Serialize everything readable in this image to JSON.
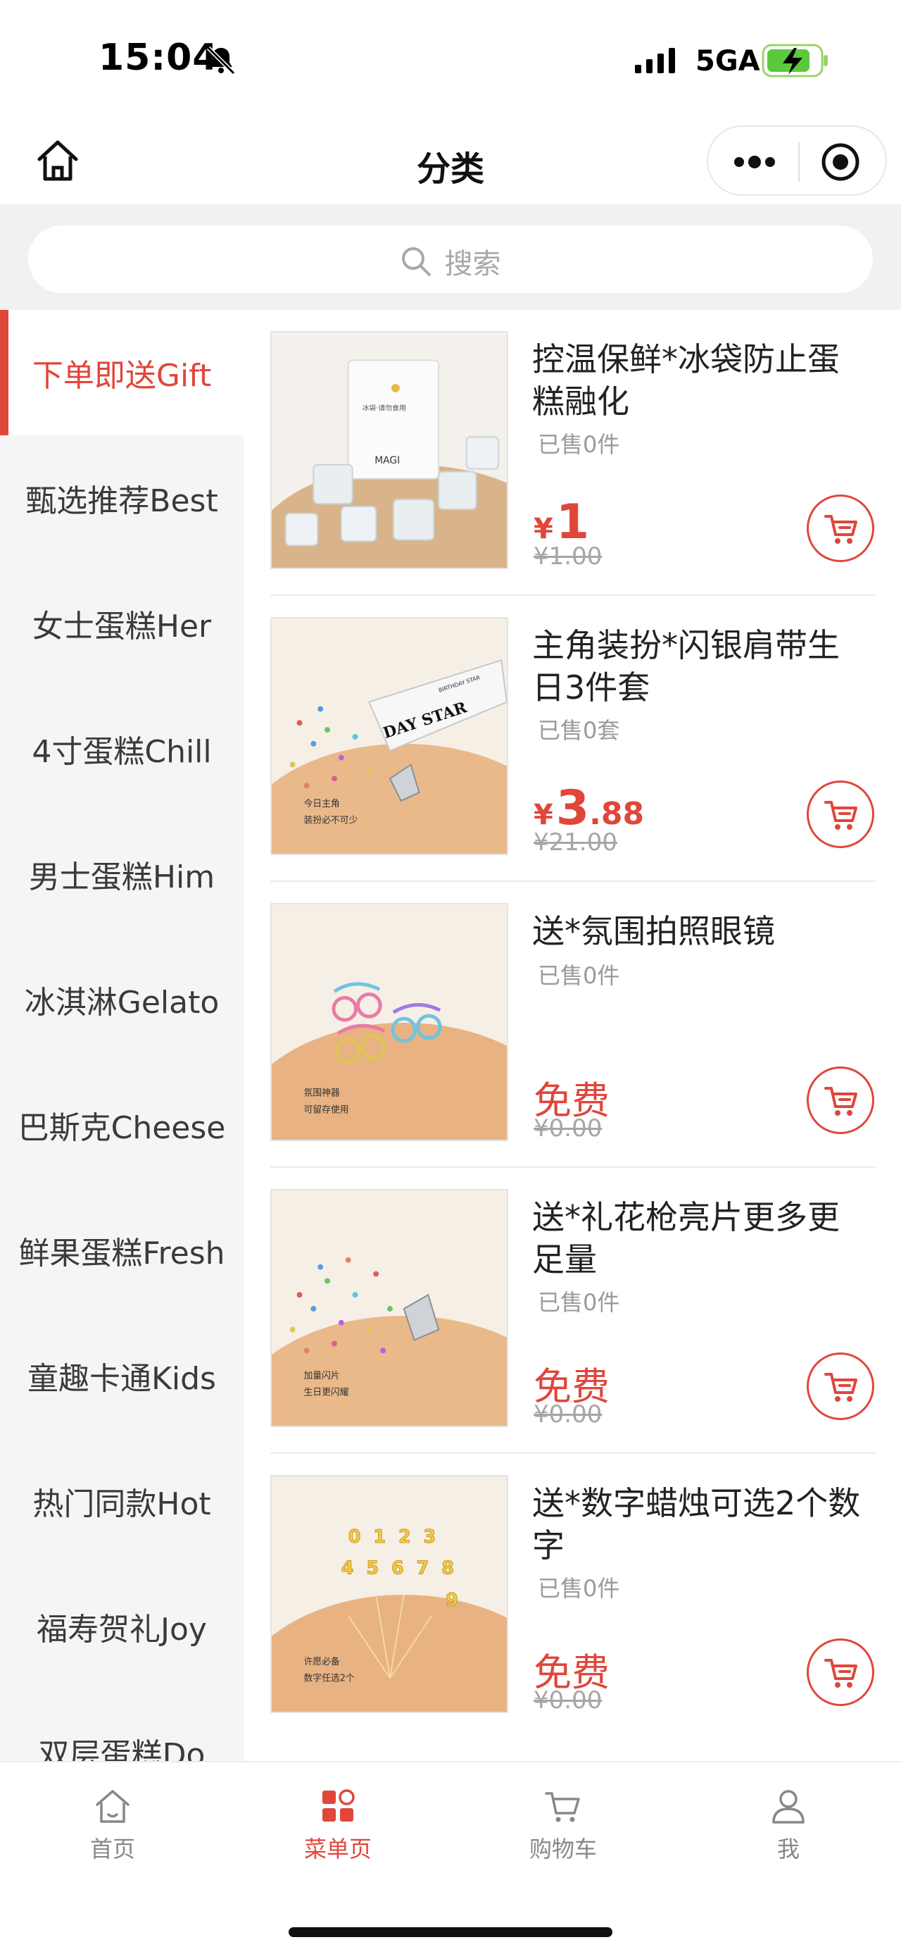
{
  "status_bar": {
    "time": "15:04",
    "network": "5GA"
  },
  "nav": {
    "title": "分类"
  },
  "search": {
    "placeholder": "搜索"
  },
  "categories": [
    {
      "label": "下单即送Gift",
      "active": true
    },
    {
      "label": "甄选推荐Best"
    },
    {
      "label": "女士蛋糕Her"
    },
    {
      "label": "4寸蛋糕Chill"
    },
    {
      "label": "男士蛋糕Him"
    },
    {
      "label": "冰淇淋Gelato"
    },
    {
      "label": "巴斯克Cheese"
    },
    {
      "label": "鲜果蛋糕Fresh"
    },
    {
      "label": "童趣卡通Kids"
    },
    {
      "label": "热门同款Hot"
    },
    {
      "label": "福寿贺礼Joy"
    },
    {
      "label": "双层蛋糕Do"
    }
  ],
  "products": [
    {
      "name": "控温保鲜*冰袋防止蛋糕融化",
      "sold": "已售0件",
      "price_symbol": "¥",
      "price_int": "1",
      "price_dec": "",
      "original_price": "¥1.00",
      "image_texts": [
        "MAGI",
        "冰袋·请勿食用"
      ]
    },
    {
      "name": "主角装扮*闪银肩带生日3件套",
      "sold": "已售0套",
      "price_symbol": "¥",
      "price_int": "3",
      "price_dec": ".88",
      "original_price": "¥21.00",
      "image_texts": [
        "DAY STAR",
        "BIRTHDAY STAR",
        "今日主角",
        "装扮必不可少"
      ]
    },
    {
      "name": "送*氛围拍照眼镜",
      "sold": "已售0件",
      "price_free": "免费",
      "original_price": "¥0.00",
      "image_texts": [
        "氛围神器",
        "可留存使用"
      ]
    },
    {
      "name": "送*礼花枪亮片更多更足量",
      "sold": "已售0件",
      "price_free": "免费",
      "original_price": "¥0.00",
      "image_texts": [
        "加量闪片",
        "生日更闪耀"
      ]
    },
    {
      "name": "送*数字蜡烛可选2个数字",
      "sold": "已售0件",
      "price_free": "免费",
      "original_price": "¥0.00",
      "image_texts": [
        "许愿必备",
        "数字任选2个",
        "0",
        "1",
        "2",
        "3",
        "4",
        "5",
        "6",
        "7",
        "8",
        "9"
      ]
    }
  ],
  "tabs": [
    {
      "label": "首页",
      "icon": "home-icon"
    },
    {
      "label": "菜单页",
      "icon": "menu-grid-icon",
      "active": true
    },
    {
      "label": "购物车",
      "icon": "cart-icon"
    },
    {
      "label": "我",
      "icon": "user-icon"
    }
  ],
  "colors": {
    "accent": "#e0463a",
    "sidebar_bg": "#f5f5f7",
    "page_bg": "#f1f1f4"
  }
}
